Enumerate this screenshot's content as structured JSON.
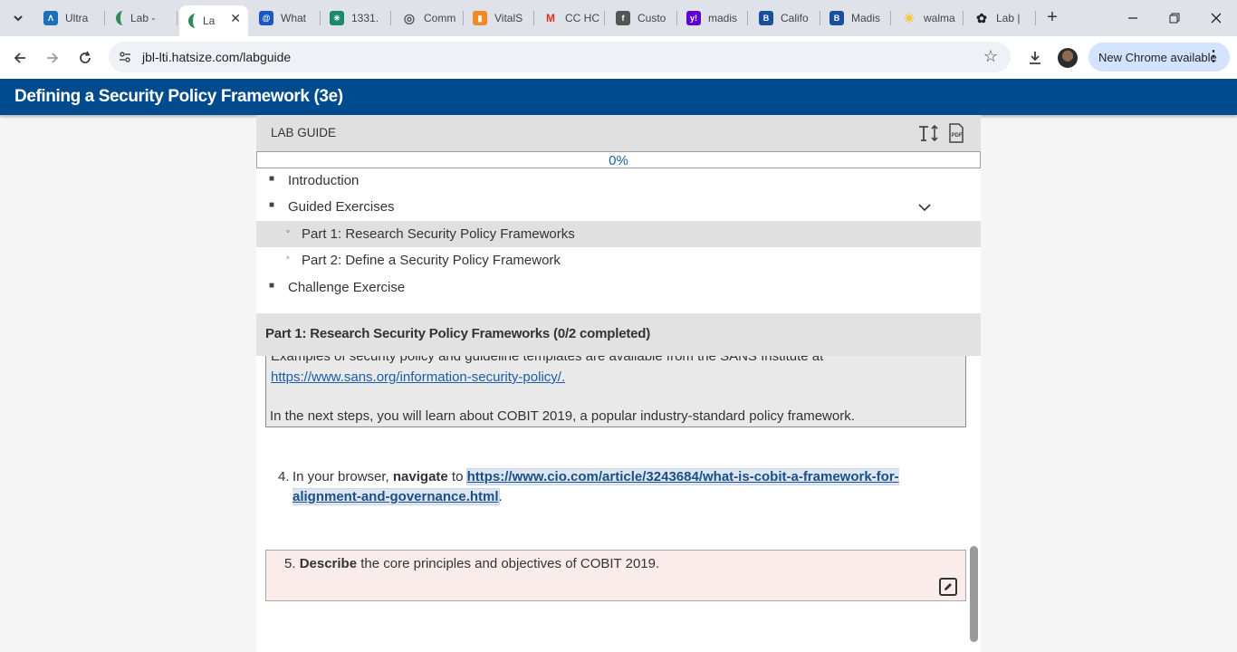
{
  "browser": {
    "tabs": [
      {
        "label": "Ultra",
        "icon": "ultra-icon",
        "color": "#1f6fb5"
      },
      {
        "label": "Lab -",
        "icon": "lab-icon",
        "color": "#2e8b57"
      },
      {
        "label": "La",
        "icon": "lab-icon",
        "color": "#2e8b57",
        "active": true
      },
      {
        "label": "What",
        "icon": "at-icon",
        "color": "#1a56c4"
      },
      {
        "label": "1331.",
        "icon": "cross-icon",
        "color": "#1a8a6a"
      },
      {
        "label": "Comm",
        "icon": "globe-icon",
        "color": "#555555"
      },
      {
        "label": "VitalS",
        "icon": "vitalsource-icon",
        "color": "#f08a24"
      },
      {
        "label": "CC HC",
        "icon": "gmail-icon",
        "color": "#d93025"
      },
      {
        "label": "Custo",
        "icon": "f-icon",
        "color": "#555555"
      },
      {
        "label": "madis",
        "icon": "yahoo-icon",
        "color": "#6001d2"
      },
      {
        "label": "Califo",
        "icon": "b-icon",
        "color": "#1a4f9c"
      },
      {
        "label": "Madis",
        "icon": "b-icon",
        "color": "#1a4f9c"
      },
      {
        "label": "walma",
        "icon": "walmart-icon",
        "color": "#ffc220"
      },
      {
        "label": "Lab |",
        "icon": "openai-icon",
        "color": "#222222"
      }
    ],
    "url": "jbl-lti.hatsize.com/labguide",
    "update_pill": "New Chrome available"
  },
  "app": {
    "title": "Defining a Security Policy Framework (3e)"
  },
  "guide": {
    "header": "LAB GUIDE",
    "progress_text": "0%",
    "progress_value": 0,
    "toc": [
      {
        "label": "Introduction",
        "level": 1
      },
      {
        "label": "Guided Exercises",
        "level": 1,
        "expanded": true
      },
      {
        "label": "Part 1: Research Security Policy Frameworks",
        "level": 2,
        "selected": true
      },
      {
        "label": "Part 2: Define a Security Policy Framework",
        "level": 2
      },
      {
        "label": "Challenge Exercise",
        "level": 1
      }
    ],
    "section_title": "Part 1: Research Security Policy Frameworks (0/2 completed)",
    "note": {
      "clipped_text": "Examples of security policy and guideline templates are available from the SANS Institute at",
      "link": "https://www.sans.org/information-security-policy/.",
      "paragraph": "In the next steps, you will learn about COBIT 2019, a popular industry-standard policy framework."
    },
    "step4": {
      "number": "4.",
      "prefix": "In your browser,",
      "verb": "navigate",
      "to": "to",
      "link": "https://www.cio.com/article/3243684/what-is-cobit-a-framework-for-alignment-and-governance.html",
      "suffix": "."
    },
    "step5": {
      "number": "5.",
      "verb": "Describe",
      "rest": "the core principles and objectives of COBIT 2019."
    }
  }
}
